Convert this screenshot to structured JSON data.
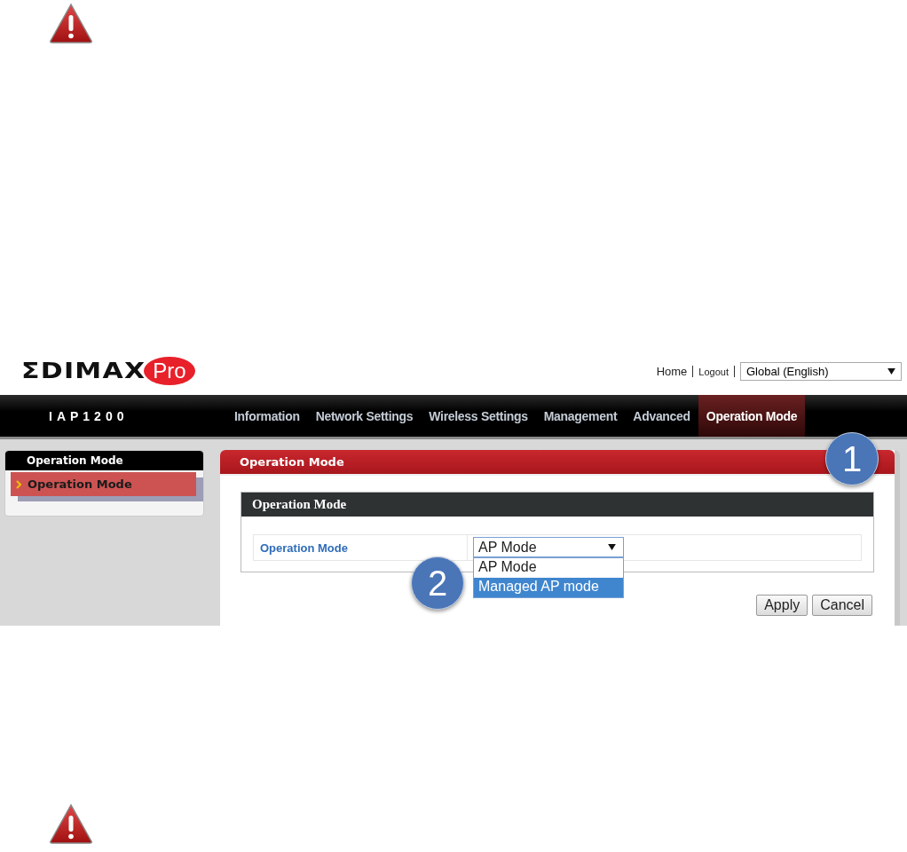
{
  "header": {
    "logo": {
      "text": "ΣDIMAX",
      "badge": "Pro"
    },
    "links": [
      "Home",
      "Logout"
    ],
    "language_select": {
      "value": "Global (English)"
    }
  },
  "nav": {
    "model": "IAP1200",
    "items": [
      {
        "label": "Information",
        "selected": false
      },
      {
        "label": "Network Settings",
        "selected": false
      },
      {
        "label": "Wireless Settings",
        "selected": false
      },
      {
        "label": "Management",
        "selected": false
      },
      {
        "label": "Advanced",
        "selected": false
      },
      {
        "label": "Operation Mode",
        "selected": true
      }
    ]
  },
  "sidebar": {
    "title": "Operation Mode",
    "items": [
      {
        "label": "Operation Mode",
        "selected": true
      }
    ]
  },
  "panel": {
    "title": "Operation Mode",
    "section": {
      "title": "Operation Mode",
      "fields": [
        {
          "label": "Operation Mode",
          "value": "AP Mode",
          "expanded": true,
          "options": [
            {
              "label": "AP Mode",
              "highlighted": false
            },
            {
              "label": "Managed AP mode",
              "highlighted": true
            }
          ]
        }
      ]
    },
    "buttons": [
      "Apply",
      "Cancel"
    ]
  },
  "callouts": [
    "1",
    "2"
  ]
}
